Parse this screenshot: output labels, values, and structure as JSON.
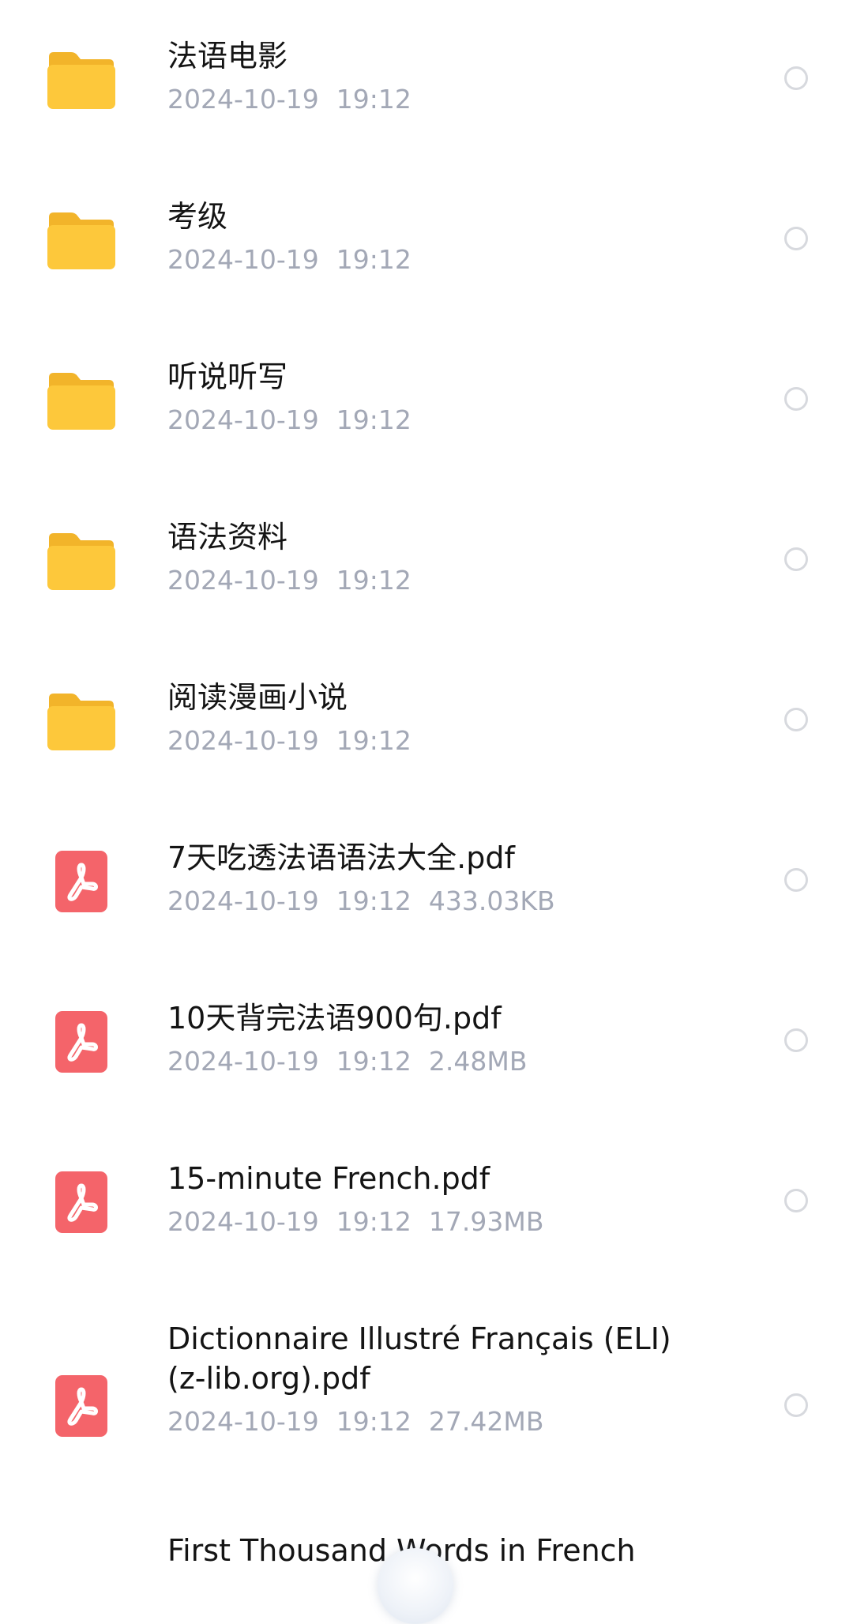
{
  "colors": {
    "folder": "#FDC83B",
    "pdf": "#F4646A",
    "meta_text": "#A3A8B6",
    "radio_border": "#D7D9DE"
  },
  "items": [
    {
      "type": "folder",
      "icon": "folder-icon",
      "name": "法语电影",
      "date": "2024-10-19",
      "time": "19:12",
      "size": ""
    },
    {
      "type": "folder",
      "icon": "folder-icon",
      "name": "考级",
      "date": "2024-10-19",
      "time": "19:12",
      "size": ""
    },
    {
      "type": "folder",
      "icon": "folder-icon",
      "name": "听说听写",
      "date": "2024-10-19",
      "time": "19:12",
      "size": ""
    },
    {
      "type": "folder",
      "icon": "folder-icon",
      "name": "语法资料",
      "date": "2024-10-19",
      "time": "19:12",
      "size": ""
    },
    {
      "type": "folder",
      "icon": "folder-icon",
      "name": "阅读漫画小说",
      "date": "2024-10-19",
      "time": "19:12",
      "size": ""
    },
    {
      "type": "pdf",
      "icon": "pdf-icon",
      "name": "7天吃透法语语法大全.pdf",
      "date": "2024-10-19",
      "time": "19:12",
      "size": "433.03KB"
    },
    {
      "type": "pdf",
      "icon": "pdf-icon",
      "name": "10天背完法语900句.pdf",
      "date": "2024-10-19",
      "time": "19:12",
      "size": "2.48MB"
    },
    {
      "type": "pdf",
      "icon": "pdf-icon",
      "name": "15-minute French.pdf",
      "date": "2024-10-19",
      "time": "19:12",
      "size": "17.93MB"
    },
    {
      "type": "pdf",
      "icon": "pdf-icon",
      "name": "Dictionnaire Illustré Français (ELI)\n(z-lib.org).pdf",
      "date": "2024-10-19",
      "time": "19:12",
      "size": "27.42MB"
    },
    {
      "type": "pdf",
      "icon": "pdf-icon",
      "name": "First Thousand Words in French",
      "date": "",
      "time": "",
      "size": ""
    }
  ]
}
